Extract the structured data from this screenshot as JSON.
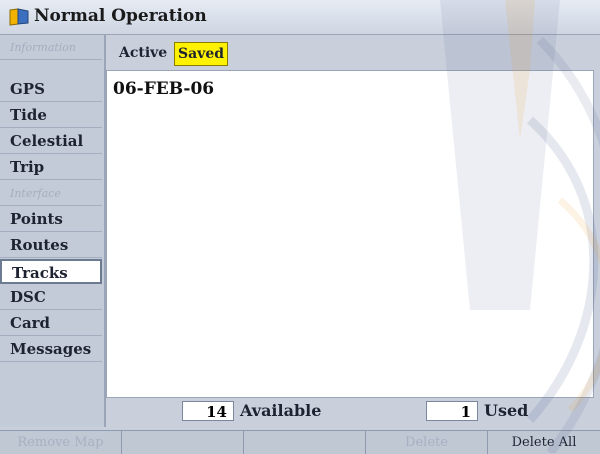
{
  "window": {
    "title": "Normal Operation",
    "icon": "garmin-flag-icon"
  },
  "sidebar": {
    "items": [
      {
        "label": "Information",
        "type": "header"
      },
      {
        "label": "GPS",
        "type": "item"
      },
      {
        "label": "Tide",
        "type": "item"
      },
      {
        "label": "Celestial",
        "type": "item"
      },
      {
        "label": "Trip",
        "type": "item"
      },
      {
        "label": "Interface",
        "type": "header"
      },
      {
        "label": "Points",
        "type": "item"
      },
      {
        "label": "Routes",
        "type": "item"
      },
      {
        "label": "Tracks",
        "type": "item",
        "selected": true
      },
      {
        "label": "DSC",
        "type": "item"
      },
      {
        "label": "Card",
        "type": "item"
      },
      {
        "label": "Messages",
        "type": "item"
      }
    ]
  },
  "tabs": {
    "active_label": "Active",
    "saved_label": "Saved"
  },
  "content": {
    "tracks": [
      "06-FEB-06"
    ]
  },
  "stats": {
    "available_value": "14",
    "available_label": "Available",
    "used_value": "1",
    "used_label": "Used"
  },
  "softkeys": {
    "key1": "Remove Map",
    "key2": "",
    "key3": "",
    "key4": "Delete",
    "key5": "Delete All"
  },
  "colors": {
    "highlight": "#fff200",
    "panel": "#c9d0dc"
  }
}
